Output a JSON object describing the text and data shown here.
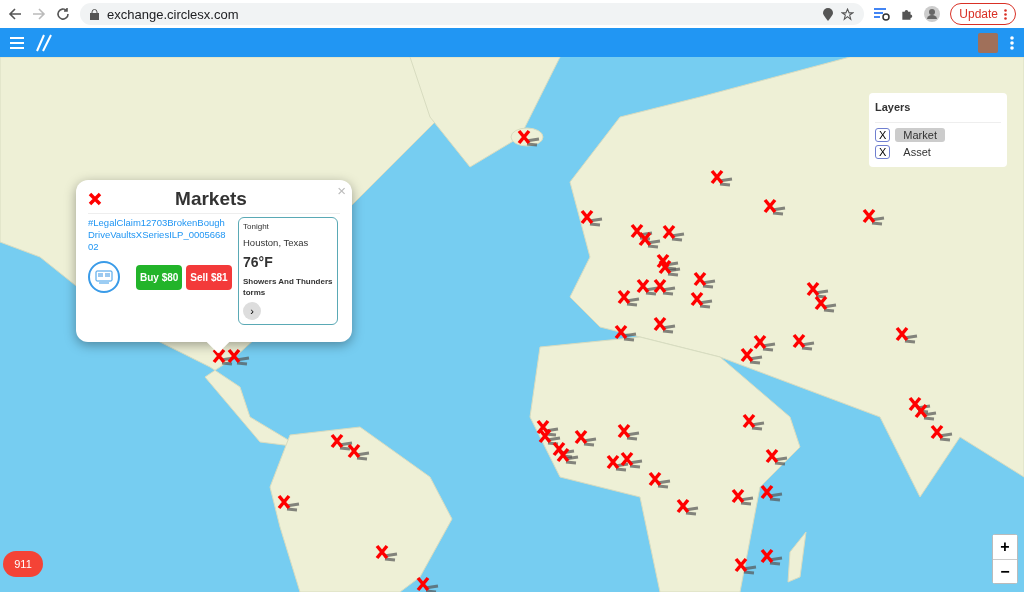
{
  "browser": {
    "url": "exchange.circlesx.com",
    "update_button": "Update"
  },
  "popup": {
    "title": "Markets",
    "close": "×",
    "link": "#LegalClaim12703BrokenBoughDriveVaultsXSeriesILP_000566802",
    "buy": "Buy $80",
    "sell": "Sell $81",
    "weather": {
      "period": "Tonight",
      "location": "Houston, Texas",
      "temperature": "76°F",
      "forecast": "Showers And Thunderstorms",
      "next": "›"
    }
  },
  "layers": {
    "title": "Layers",
    "items": [
      {
        "mark": "X",
        "label": "Market",
        "selected": true
      },
      {
        "mark": "X",
        "label": "Asset",
        "selected": false
      }
    ]
  },
  "emergency_button": "911",
  "zoom": {
    "zoom_in": "+",
    "zoom_out": "−"
  }
}
